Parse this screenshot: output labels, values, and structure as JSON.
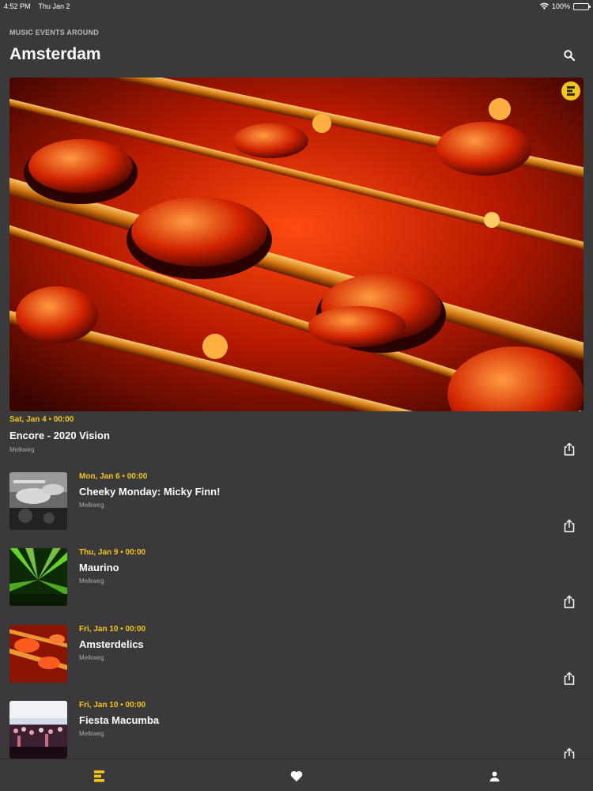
{
  "status": {
    "time": "4:52 PM",
    "date": "Thu Jan 2",
    "battery": "100%",
    "battery_level": 1.0
  },
  "header": {
    "kicker": "MUSIC EVENTS AROUND",
    "city": "Amsterdam",
    "search_icon": "search-icon"
  },
  "colors": {
    "accent": "#f5c518",
    "background": "#3a3a3b",
    "muted_text": "#a8a8a8"
  },
  "featured": {
    "date": "Sat, Jan 4 • 00:00",
    "title": "Encore - 2020 Vision",
    "venue": "Melkweg",
    "image": "saxophone-photo",
    "badge_icon": "eventbrite-logo-icon",
    "share_icon": "share-icon"
  },
  "events": [
    {
      "date": "Mon, Jan 6 • 00:00",
      "title": "Cheeky Monday: Micky Finn!",
      "venue": "Melkweg",
      "image": "dj-mixer-photo"
    },
    {
      "date": "Thu, Jan 9 • 00:00",
      "title": "Maurino",
      "venue": "Melkweg",
      "image": "green-lasers-photo"
    },
    {
      "date": "Fri, Jan 10 • 00:00",
      "title": "Amsterdelics",
      "venue": "Melkweg",
      "image": "saxophone-photo"
    },
    {
      "date": "Fri, Jan 10 • 00:00",
      "title": "Fiesta Macumba",
      "venue": "Melkweg",
      "image": "concert-crowd-photo"
    }
  ],
  "tabs": [
    {
      "name": "events",
      "icon": "events-list-icon",
      "active": true
    },
    {
      "name": "favorites",
      "icon": "heart-icon",
      "active": false
    },
    {
      "name": "profile",
      "icon": "person-icon",
      "active": false
    }
  ]
}
